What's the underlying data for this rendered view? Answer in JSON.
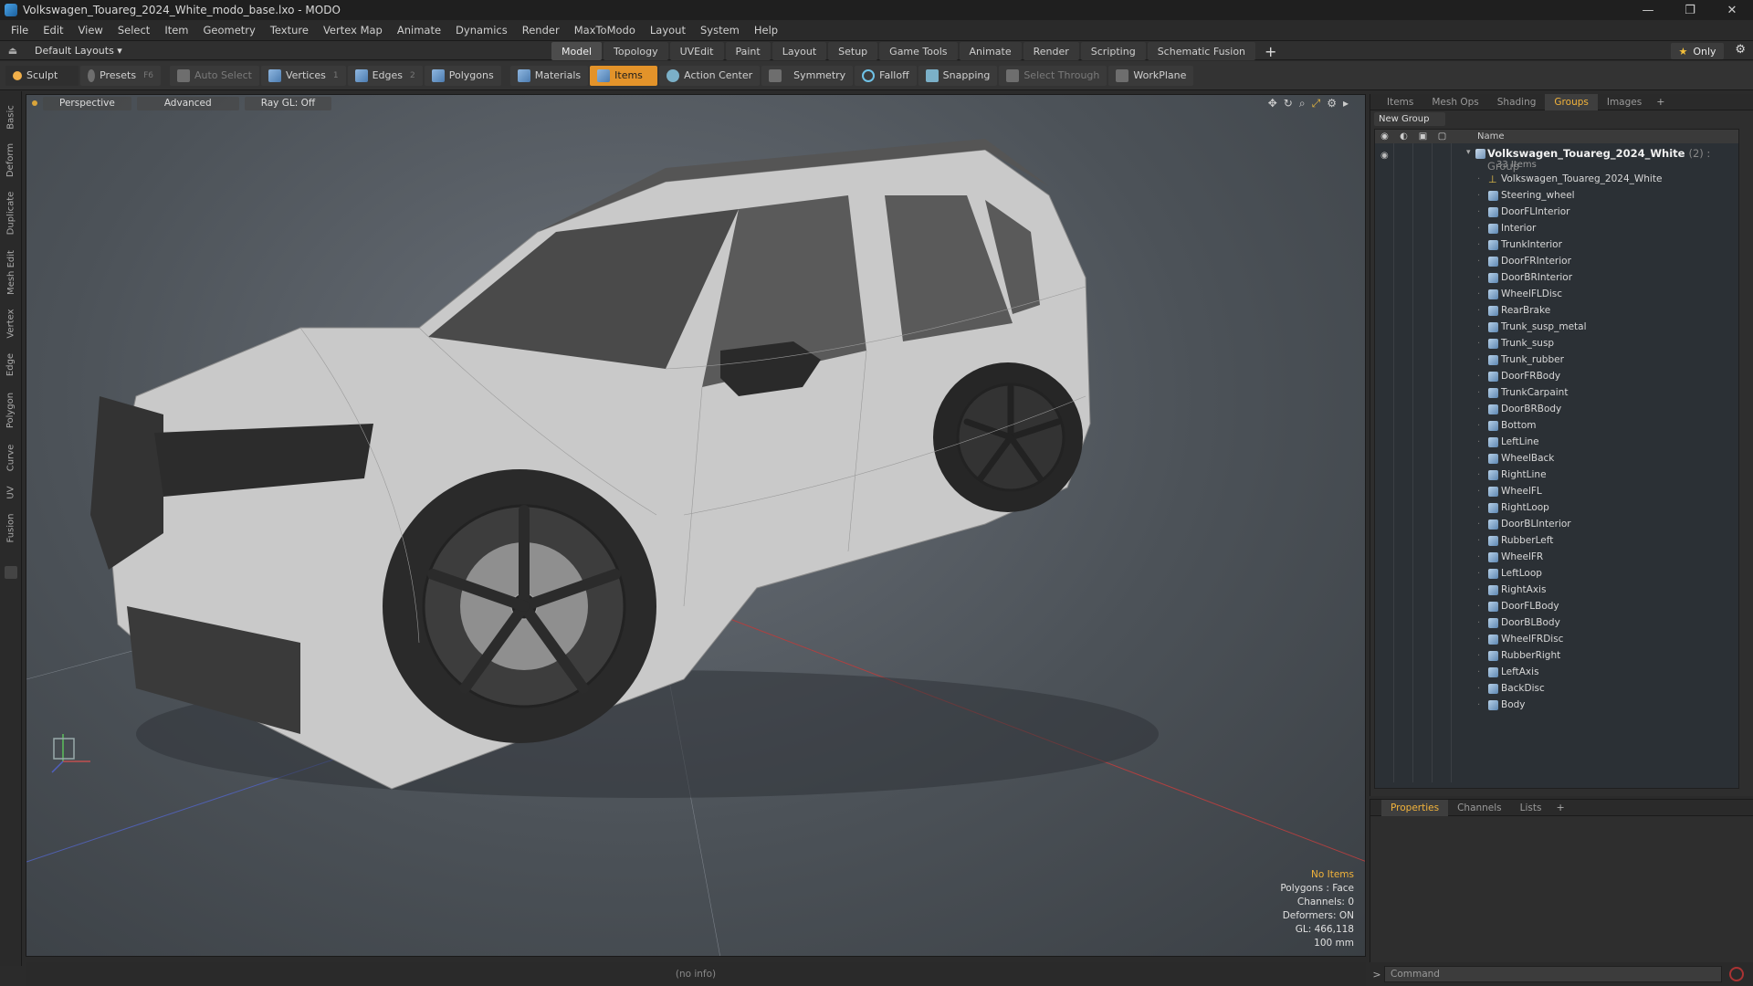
{
  "window": {
    "title": "Volkswagen_Touareg_2024_White_modo_base.lxo - MODO",
    "controls": [
      "—",
      "❐",
      "✕"
    ]
  },
  "menu": [
    "File",
    "Edit",
    "View",
    "Select",
    "Item",
    "Geometry",
    "Texture",
    "Vertex Map",
    "Animate",
    "Dynamics",
    "Render",
    "MaxToModo",
    "Layout",
    "System",
    "Help"
  ],
  "layout": {
    "selector": "Default Layouts ▾",
    "tabs": [
      "Model",
      "Topology",
      "UVEdit",
      "Paint",
      "Layout",
      "Setup",
      "Game Tools",
      "Animate",
      "Render",
      "Scripting",
      "Schematic Fusion"
    ],
    "active_tab": "Model",
    "add_tab": "+",
    "only_label": "Only",
    "only_star": "★"
  },
  "toolbar": {
    "sculpt": "Sculpt",
    "presets": "Presets",
    "presets_key": "F6",
    "auto_select": "Auto Select",
    "vertices": "Vertices",
    "vertices_count": "1",
    "edges": "Edges",
    "edges_count": "2",
    "polygons": "Polygons",
    "materials": "Materials",
    "items": "Items",
    "action_center": "Action Center",
    "symmetry": "Symmetry",
    "falloff": "Falloff",
    "snapping": "Snapping",
    "select_through": "Select Through",
    "workplane": "WorkPlane"
  },
  "left_tabs": [
    "Basic",
    "Deform",
    "Duplicate",
    "Mesh Edit",
    "Vertex",
    "Edge",
    "Polygon",
    "Curve",
    "UV",
    "Fusion"
  ],
  "viewport": {
    "view_mode": "Perspective",
    "shading": "Advanced",
    "raygl": "Ray GL: Off",
    "info": {
      "selection": "No Items",
      "polygons": "Polygons : Face",
      "channels": "Channels: 0",
      "deformers": "Deformers: ON",
      "gl": "GL: 466,118",
      "scale": "100 mm"
    }
  },
  "right_panel": {
    "tabs": [
      "Items",
      "Mesh Ops",
      "Shading",
      "Groups",
      "Images"
    ],
    "active_tab": "Groups",
    "add": "+",
    "new_group": "New Group",
    "column_name": "Name",
    "group": {
      "name": "Volkswagen_Touareg_2024_White",
      "suffix": "(2) : Group",
      "count": "33 Items"
    },
    "items": [
      "Volkswagen_Touareg_2024_White",
      "Steering_wheel",
      "DoorFLInterior",
      "Interior",
      "TrunkInterior",
      "DoorFRInterior",
      "DoorBRInterior",
      "WheelFLDisc",
      "RearBrake",
      "Trunk_susp_metal",
      "Trunk_susp",
      "Trunk_rubber",
      "DoorFRBody",
      "TrunkCarpaint",
      "DoorBRBody",
      "Bottom",
      "LeftLine",
      "WheelBack",
      "RightLine",
      "WheelFL",
      "RightLoop",
      "DoorBLInterior",
      "RubberLeft",
      "WheelFR",
      "LeftLoop",
      "RightAxis",
      "DoorFLBody",
      "DoorBLBody",
      "WheelFRDisc",
      "RubberRight",
      "LeftAxis",
      "BackDisc",
      "Body"
    ]
  },
  "properties_panel": {
    "tabs": [
      "Properties",
      "Channels",
      "Lists"
    ],
    "active_tab": "Properties",
    "add": "+"
  },
  "status": {
    "text": "(no info)"
  },
  "command": {
    "placeholder": "Command",
    "prompt": ">"
  },
  "colors": {
    "accent": "#e3932a",
    "active_text": "#f2b33b"
  }
}
